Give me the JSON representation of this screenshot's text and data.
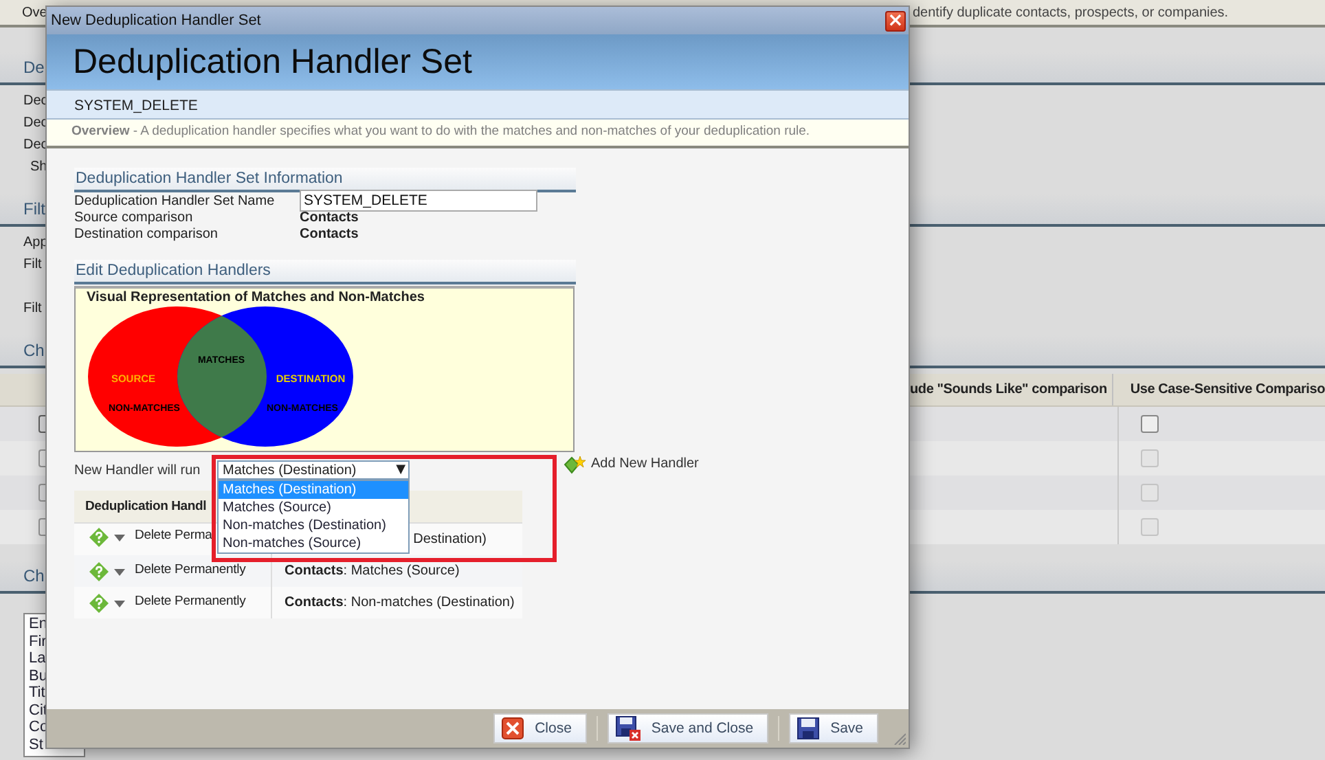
{
  "background": {
    "top_left": "Ove",
    "top_right": "dentify duplicate contacts, prospects, or companies.",
    "items": [
      {
        "kind": "heading",
        "text": "De"
      },
      {
        "kind": "line",
        "text": "Dec"
      },
      {
        "kind": "line",
        "text": "Dec"
      },
      {
        "kind": "line",
        "text": "Dec"
      },
      {
        "kind": "indent",
        "text": "Sh"
      },
      {
        "kind": "heading",
        "text": "Filt"
      },
      {
        "kind": "line",
        "text": "App"
      },
      {
        "kind": "line",
        "text": "Filt"
      },
      {
        "kind": "spaced",
        "text": "Filt"
      },
      {
        "kind": "heading",
        "text": "Ch"
      },
      {
        "kind": "table",
        "columns": [
          "ude \"Sounds Like\" comparison",
          "Use Case-Sensitive Compariso"
        ],
        "rows": [
          {
            "checked": false,
            "enabled": true
          },
          {
            "checked": false,
            "enabled": false
          },
          {
            "checked": false,
            "enabled": false
          },
          {
            "checked": false,
            "enabled": false
          }
        ]
      },
      {
        "kind": "heading",
        "text": "Ch"
      },
      {
        "kind": "listbox",
        "items": [
          "En",
          "Fir",
          "La",
          "Bu",
          "Tit",
          "Cit",
          "Co",
          "St"
        ]
      }
    ]
  },
  "dialog": {
    "title": "New Deduplication Handler Set",
    "close": "×",
    "heading": "Deduplication Handler Set",
    "subtitle": "SYSTEM_DELETE",
    "overview": "**Overview** - A deduplication handler specifies what you want to do with the matches and non-matches of your deduplication rule.",
    "info": {
      "title": "Deduplication Handler Set Information",
      "name_label": "Deduplication Handler Set Name",
      "name_value": "SYSTEM_DELETE",
      "rows": [
        {
          "label": "Source comparison",
          "value": "Contacts"
        },
        {
          "label": "Destination comparison",
          "value": "Contacts"
        }
      ]
    },
    "handlers": {
      "title": "Edit Deduplication Handlers",
      "venn": {
        "title": "Visual Representation of Matches and Non-Matches",
        "matches": "MATCHES",
        "source": "SOURCE",
        "destination": "DESTINATION",
        "source_non": "NON-MATCHES",
        "destination_non": "NON-MATCHES"
      },
      "run_on_label": "New Handler will run",
      "dropdown": {
        "value": "Matches (Destination)",
        "arrow": "▼",
        "options": [
          {
            "label": "Matches (Destination)",
            "selected": true
          },
          {
            "label": "Matches (Source)",
            "selected": false
          },
          {
            "label": "Non-matches (Destination)",
            "selected": false
          },
          {
            "label": "Non-matches (Source)",
            "selected": false
          }
        ]
      },
      "add_button": "Add New Handler",
      "table": {
        "header": "Deduplication Handl",
        "rows": [
          {
            "action": "Delete Perma",
            "target": "Destination)",
            "covered": true
          },
          {
            "action": "Delete Permanently",
            "target": "**Contacts**: Matches (Source)",
            "covered": false
          },
          {
            "action": "Delete Permanently",
            "target": "**Contacts**: Non-matches (Destination)",
            "covered": false
          }
        ]
      }
    },
    "buttons": [
      {
        "kind": "close",
        "label": "Close"
      },
      {
        "kind": "save_close",
        "label": "Save and Close"
      },
      {
        "kind": "save",
        "label": "Save"
      }
    ]
  }
}
